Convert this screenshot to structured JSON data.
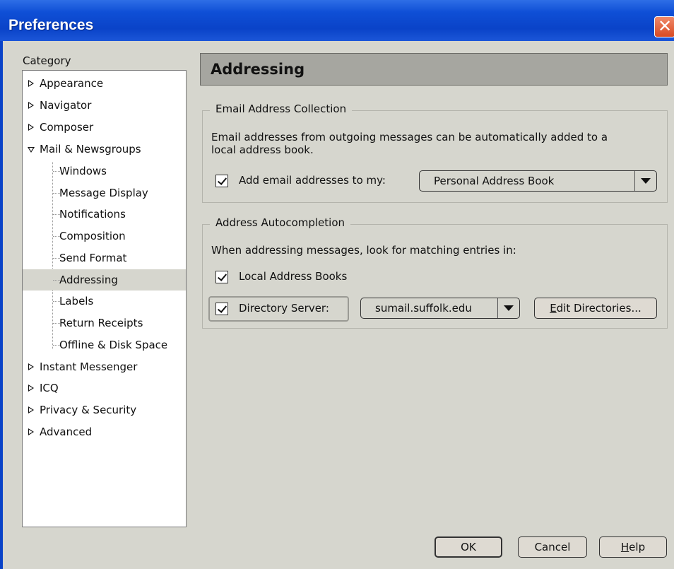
{
  "window": {
    "title": "Preferences",
    "close_glyph": "✕"
  },
  "sidebar": {
    "category_label": "Category",
    "items": [
      {
        "label": "Appearance",
        "expander": "collapsed"
      },
      {
        "label": "Navigator",
        "expander": "collapsed"
      },
      {
        "label": "Composer",
        "expander": "collapsed"
      },
      {
        "label": "Mail & Newsgroups",
        "expander": "expanded"
      },
      {
        "label": "Windows",
        "child": true
      },
      {
        "label": "Message Display",
        "child": true
      },
      {
        "label": "Notifications",
        "child": true
      },
      {
        "label": "Composition",
        "child": true
      },
      {
        "label": "Send Format",
        "child": true
      },
      {
        "label": "Addressing",
        "child": true,
        "selected": true
      },
      {
        "label": "Labels",
        "child": true
      },
      {
        "label": "Return Receipts",
        "child": true
      },
      {
        "label": "Offline & Disk Space",
        "child": true
      },
      {
        "label": "Instant Messenger",
        "expander": "collapsed"
      },
      {
        "label": "ICQ",
        "expander": "collapsed"
      },
      {
        "label": "Privacy & Security",
        "expander": "collapsed"
      },
      {
        "label": "Advanced",
        "expander": "collapsed"
      }
    ]
  },
  "panel": {
    "title": "Addressing",
    "email_collection": {
      "group_title": "Email Address Collection",
      "description_line1": "Email addresses from outgoing messages can be automatically added to a",
      "description_line2": "local address book.",
      "checkbox_label": "Add email addresses to my:",
      "checked": true,
      "address_book": "Personal Address Book"
    },
    "autocompletion": {
      "group_title": "Address Autocompletion",
      "description": "When addressing messages, look for matching entries in:",
      "local_label": "Local Address Books",
      "local_checked": true,
      "directory_label": "Directory Server:",
      "directory_checked": true,
      "directory_server": "sumail.suffolk.edu",
      "edit_button": "Edit Directories...",
      "edit_button_mnemonic": "E",
      "edit_button_rest": "dit Directories..."
    }
  },
  "footer": {
    "ok": "OK",
    "cancel": "Cancel",
    "help_mnemonic": "H",
    "help_rest": "elp"
  },
  "colors": {
    "titlebar": "#0a43c8",
    "dialog_bg": "#d6d6ce",
    "selection": "#d6d6ce",
    "header_bg": "#a6a6a0"
  }
}
